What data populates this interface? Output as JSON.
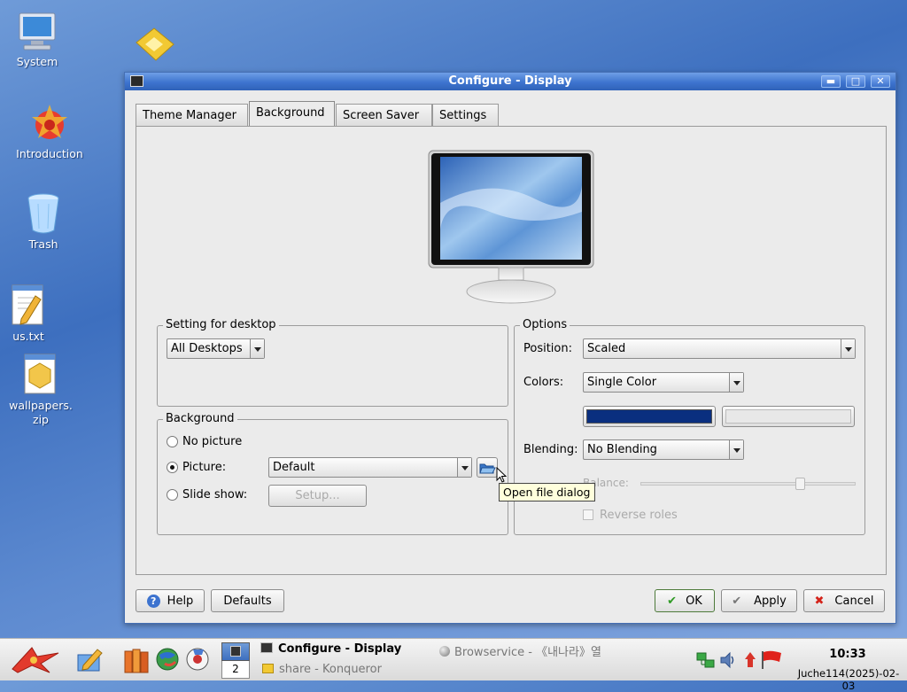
{
  "desktop": {
    "icons": [
      {
        "label": "System"
      },
      {
        "label": "Introduction"
      },
      {
        "label": "Trash"
      },
      {
        "label": "us.txt"
      },
      {
        "label": "wallpapers.zip"
      }
    ]
  },
  "window": {
    "title": "Configure - Display",
    "controls": {
      "minimize": "▬",
      "maximize": "□",
      "close": "✕"
    },
    "tabs": [
      {
        "label": "Theme Manager"
      },
      {
        "label": "Background"
      },
      {
        "label": "Screen Saver"
      },
      {
        "label": "Settings"
      }
    ],
    "setting_for_desktop": {
      "title": "Setting for desktop",
      "value": "All Desktops"
    },
    "background": {
      "title": "Background",
      "no_picture": "No picture",
      "picture": "Picture:",
      "picture_value": "Default",
      "slide_show": "Slide show:",
      "setup": "Setup..."
    },
    "options": {
      "title": "Options",
      "position_label": "Position:",
      "position_value": "Scaled",
      "colors_label": "Colors:",
      "colors_value": "Single Color",
      "primary_color": "#0a2f7f",
      "secondary_color": "#e8e8e8",
      "blending_label": "Blending:",
      "blending_value": "No Blending",
      "balance_label": "Balance:",
      "reverse_roles": "Reverse roles"
    },
    "tooltip": "Open file dialog",
    "buttons": {
      "help": "Help",
      "defaults": "Defaults",
      "ok": "OK",
      "apply": "Apply",
      "cancel": "Cancel"
    }
  },
  "taskbar": {
    "desktop_number": "2",
    "tasks": [
      {
        "label": "Configure - Display"
      },
      {
        "label": "Browservice - 《내나라》열"
      },
      {
        "label": "share - Konqueror"
      }
    ],
    "clock": {
      "time": "10:33",
      "date": "Juche114(2025)-02-03"
    }
  }
}
